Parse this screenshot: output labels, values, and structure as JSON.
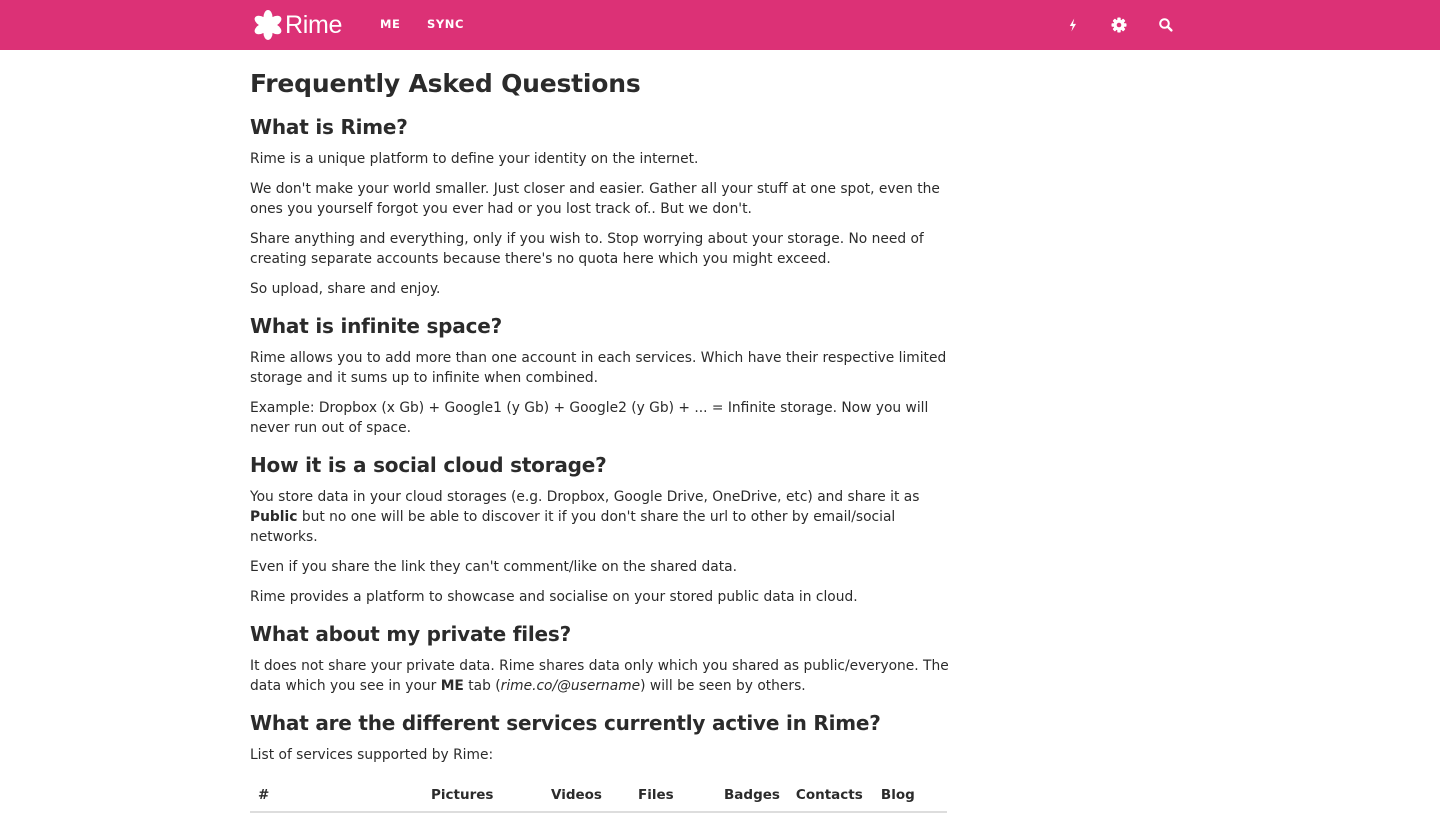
{
  "header": {
    "logo_text": "Rime",
    "nav": [
      {
        "label": "ME"
      },
      {
        "label": "SYNC"
      }
    ],
    "icons": [
      "bolt-icon",
      "gear-icon",
      "search-icon"
    ],
    "bar_color": "#dc3176"
  },
  "main": {
    "title": "Frequently Asked Questions",
    "sections": [
      {
        "heading": "What is Rime?",
        "paragraphs": [
          "Rime is a unique platform to define your identity on the internet.",
          "We don't make your world smaller. Just closer and easier. Gather all your stuff at one spot, even the ones you yourself forgot you ever had or you lost track of.. But we don't.",
          "Share anything and everything, only if you wish to. Stop worrying about your storage. No need of creating separate accounts because there's no quota here which you might exceed.",
          "So upload, share and enjoy."
        ]
      },
      {
        "heading": "What is infinite space?",
        "paragraphs": [
          "Rime allows you to add more than one account in each services. Which have their respective limited storage and it sums up to infinite when combined.",
          "Example: Dropbox (x Gb) + Google1 (y Gb) + Google2 (y Gb) + ... = Infinite storage. Now you will never run out of space."
        ]
      },
      {
        "heading": "How it is a social cloud storage?",
        "p1_before": "You store data in your cloud storages (e.g. Dropbox, Google Drive, OneDrive, etc) and share it as ",
        "p1_bold": "Public",
        "p1_after": " but no one will be able to discover it if you don't share the url to other by email/social networks.",
        "p2": "Even if you share the link they can't comment/like on the shared data.",
        "p3": "Rime provides a platform to showcase and socialise on your stored public data in cloud."
      },
      {
        "heading": "What about my private files?",
        "p1_before": "It does not share your private data. Rime shares data only which you shared as public/everyone. The data which you see in your ",
        "p1_bold": "ME",
        "p1_mid": " tab (",
        "p1_italic": "rime.co/@username",
        "p1_after": ") will be seen by others."
      },
      {
        "heading": "What are the different services currently active in Rime?",
        "intro": "List of services supported by Rime:",
        "table_headers": [
          "#",
          "Pictures",
          "Videos",
          "Files",
          "Badges",
          "Contacts",
          "Blog"
        ]
      }
    ]
  }
}
